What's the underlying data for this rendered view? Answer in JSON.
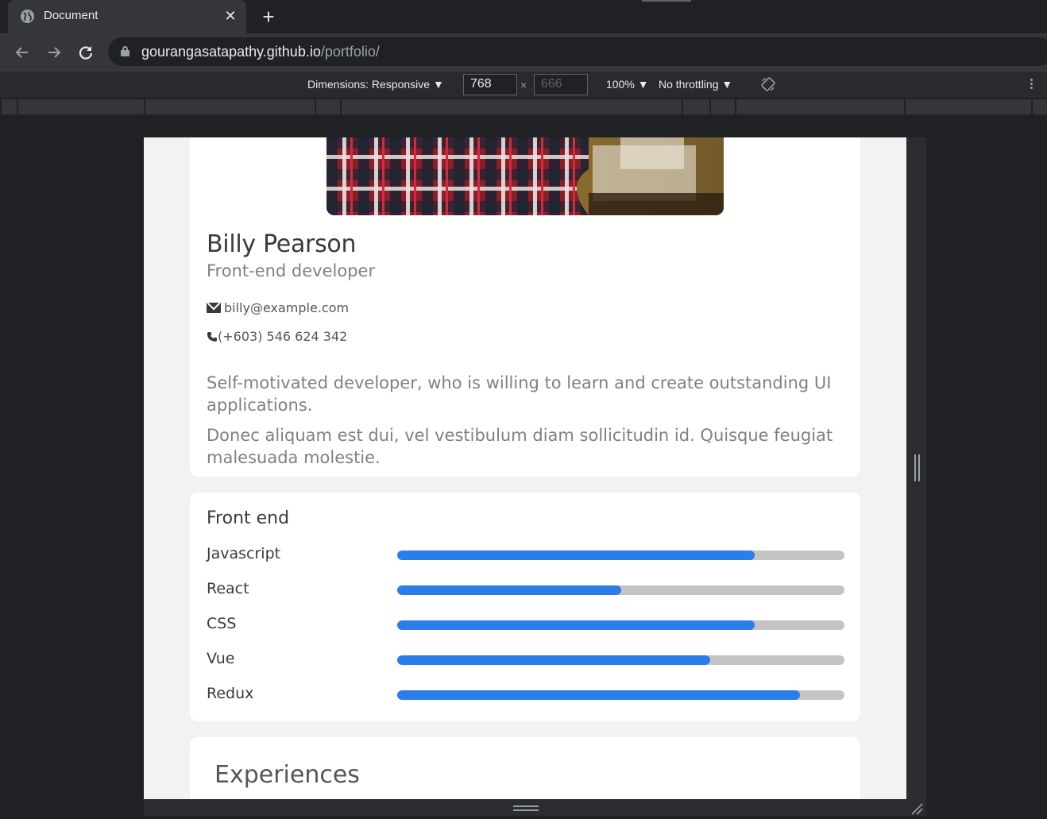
{
  "browser": {
    "tab_title": "Document",
    "tab_close": "✕",
    "new_tab": "+",
    "url_host": "gourangasatapathy.github.io",
    "url_path": "/portfolio/"
  },
  "devtools": {
    "dimensions_label": "Dimensions: Responsive ▼",
    "width": "768",
    "height": "666",
    "times": "×",
    "zoom": "100% ▼",
    "throttling": "No throttling ▼"
  },
  "profile": {
    "name": "Billy Pearson",
    "role": "Front-end developer",
    "email": "billy@example.com",
    "phone": "(+603) 546 624 342",
    "bio": [
      "Self-motivated developer, who is willing to learn and create outstanding UI applications.",
      "Donec aliquam est dui, vel vestibulum diam sollicitudin id. Quisque feugiat malesuada molestie."
    ]
  },
  "skills": {
    "title": "Front end",
    "accent_color": "#2b7de9",
    "track_color": "#c4c4c4",
    "items": [
      {
        "label": "Javascript",
        "level": 0.8
      },
      {
        "label": "React",
        "level": 0.5
      },
      {
        "label": "CSS",
        "level": 0.8
      },
      {
        "label": "Vue",
        "level": 0.7
      },
      {
        "label": "Redux",
        "level": 0.9
      }
    ]
  },
  "experiences": {
    "title": "Experiences"
  }
}
